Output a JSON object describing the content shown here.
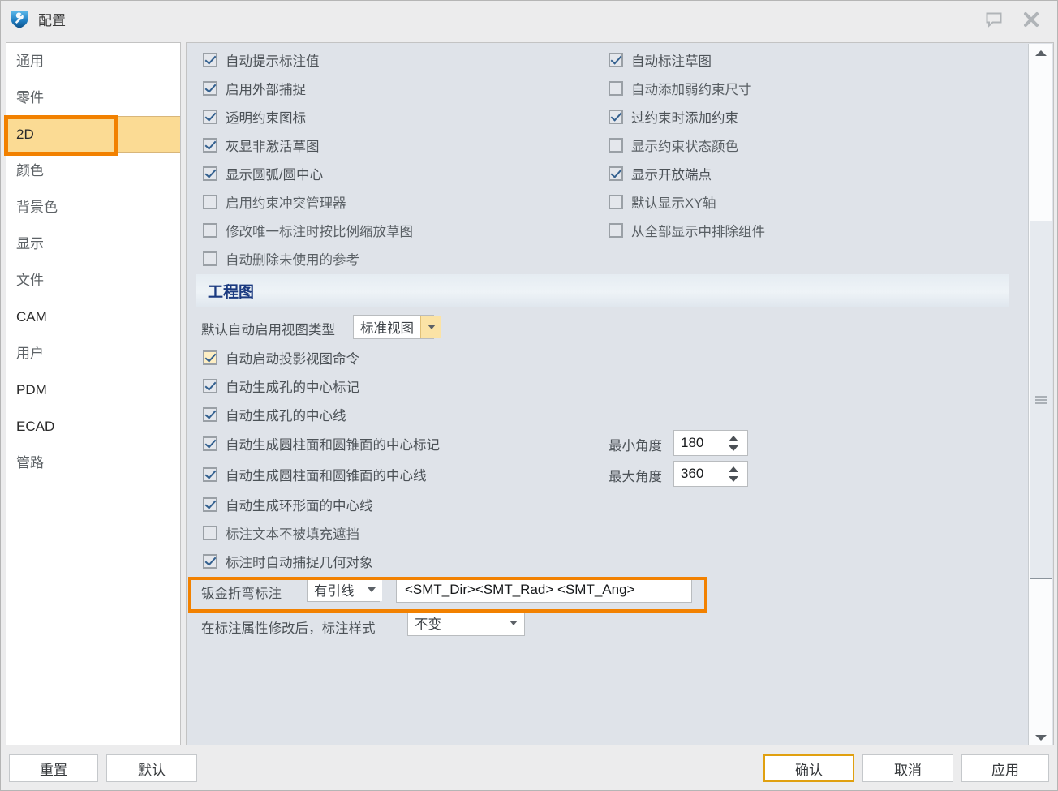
{
  "window": {
    "title": "配置",
    "logo_icon": "shield-tool-icon",
    "help_icon": "speech-bubble-icon",
    "close_icon": "close-x-icon"
  },
  "sidebar": {
    "items": [
      {
        "label": "通用",
        "selected": false,
        "latin": false
      },
      {
        "label": "零件",
        "selected": false,
        "latin": false
      },
      {
        "label": "2D",
        "selected": true,
        "latin": true
      },
      {
        "label": "颜色",
        "selected": false,
        "latin": false
      },
      {
        "label": "背景色",
        "selected": false,
        "latin": false
      },
      {
        "label": "显示",
        "selected": false,
        "latin": false
      },
      {
        "label": "文件",
        "selected": false,
        "latin": false
      },
      {
        "label": "CAM",
        "selected": false,
        "latin": true
      },
      {
        "label": "用户",
        "selected": false,
        "latin": false
      },
      {
        "label": "PDM",
        "selected": false,
        "latin": true
      },
      {
        "label": "ECAD",
        "selected": false,
        "latin": true
      },
      {
        "label": "管路",
        "selected": false,
        "latin": false
      }
    ]
  },
  "sketch_options": {
    "left_column": [
      {
        "label": "自动提示标注值",
        "checked": true,
        "hover": false
      },
      {
        "label": "启用外部捕捉",
        "checked": true,
        "hover": false
      },
      {
        "label": "透明约束图标",
        "checked": true,
        "hover": false
      },
      {
        "label": "灰显非激活草图",
        "checked": true,
        "hover": false
      },
      {
        "label": "显示圆弧/圆中心",
        "checked": true,
        "hover": false
      },
      {
        "label": "启用约束冲突管理器",
        "checked": false,
        "hover": false
      },
      {
        "label": "修改唯一标注时按比例缩放草图",
        "checked": false,
        "hover": false
      },
      {
        "label": "自动删除未使用的参考",
        "checked": false,
        "hover": false
      }
    ],
    "right_column": [
      {
        "label": "自动标注草图",
        "checked": true,
        "hover": false
      },
      {
        "label": "自动添加弱约束尺寸",
        "checked": false,
        "hover": false
      },
      {
        "label": "过约束时添加约束",
        "checked": true,
        "hover": false
      },
      {
        "label": "显示约束状态颜色",
        "checked": false,
        "hover": false
      },
      {
        "label": "显示开放端点",
        "checked": true,
        "hover": false
      },
      {
        "label": "默认显示XY轴",
        "checked": false,
        "hover": false
      },
      {
        "label": "从全部显示中排除组件",
        "checked": false,
        "hover": false
      }
    ]
  },
  "drawing_section": {
    "title": "工程图",
    "view_type": {
      "label": "默认自动启用视图类型",
      "value": "标准视图"
    },
    "options": [
      {
        "label": "自动启动投影视图命令",
        "checked": true,
        "hover": true
      },
      {
        "label": "自动生成孔的中心标记",
        "checked": true,
        "hover": false
      },
      {
        "label": "自动生成孔的中心线",
        "checked": true,
        "hover": false
      },
      {
        "label": "自动生成圆柱面和圆锥面的中心标记",
        "checked": true,
        "hover": false
      },
      {
        "label": "自动生成圆柱面和圆锥面的中心线",
        "checked": true,
        "hover": false
      },
      {
        "label": "自动生成环形面的中心线",
        "checked": true,
        "hover": false
      },
      {
        "label": "标注文本不被填充遮挡",
        "checked": false,
        "hover": false
      },
      {
        "label": "标注时自动捕捉几何对象",
        "checked": true,
        "hover": false
      }
    ],
    "min_angle": {
      "label": "最小角度",
      "value": "180"
    },
    "max_angle": {
      "label": "最大角度",
      "value": "360"
    },
    "bend_note": {
      "label": "钣金折弯标注",
      "mode": "有引线",
      "format": "<SMT_Dir><SMT_Rad> <SMT_Ang>"
    },
    "dim_style": {
      "label": "在标注属性修改后，标注样式",
      "value": "不变"
    }
  },
  "scrollbar": {
    "up_arrow_icon": "caret-up-icon",
    "down_arrow_icon": "caret-down-icon",
    "grip_icon": "grip-lines-icon"
  },
  "footer": {
    "reset_label": "重置",
    "default_label": "默认",
    "ok_label": "确认",
    "cancel_label": "取消",
    "apply_label": "应用"
  },
  "colors": {
    "annotation": "#f28100",
    "selection": "#fbdb94",
    "panel_bg": "#dfe3e9",
    "primary_border": "#e0a010"
  }
}
